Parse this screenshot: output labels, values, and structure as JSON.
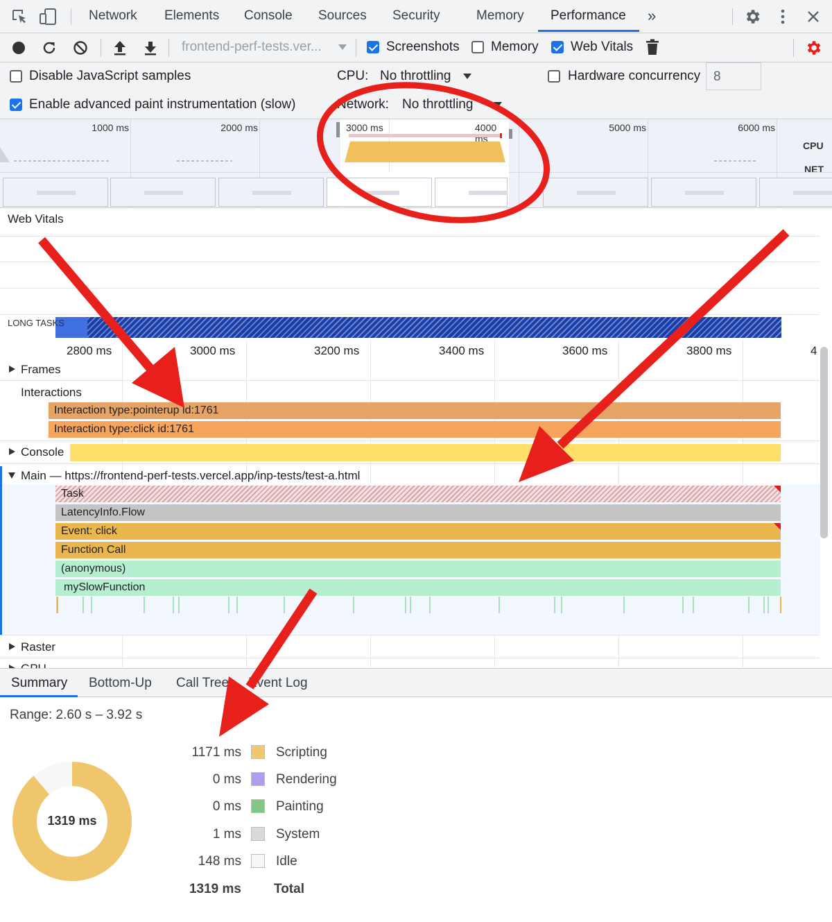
{
  "tabs": [
    "Network",
    "Elements",
    "Console",
    "Sources",
    "Security",
    "Memory",
    "Performance"
  ],
  "active_tab": "Performance",
  "more_tabs_glyph": "»",
  "toolbar": {
    "profile_select": "frontend-perf-tests.ver...",
    "screenshots_label": "Screenshots",
    "screenshots_checked": true,
    "memory_label": "Memory",
    "memory_checked": false,
    "webvitals_label": "Web Vitals",
    "webvitals_checked": true
  },
  "settings": {
    "disable_js_samples": "Disable JavaScript samples",
    "advanced_paint": "Enable advanced paint instrumentation (slow)",
    "cpu_label": "CPU:",
    "cpu_value": "No throttling",
    "network_label": "Network:",
    "network_value": "No throttling",
    "hw_label": "Hardware concurrency",
    "hw_value": "8"
  },
  "overview": {
    "ticks": [
      "1000 ms",
      "2000 ms",
      "3000 ms",
      "4000 ms",
      "5000 ms",
      "6000 ms"
    ],
    "cpu_label": "CPU",
    "net_label": "NET"
  },
  "timeline": {
    "web_vitals": "Web Vitals",
    "long_tasks": "LONG TASKS",
    "ruler": [
      "2800 ms",
      "3000 ms",
      "3200 ms",
      "3400 ms",
      "3600 ms",
      "3800 ms",
      "4"
    ],
    "frames": "Frames",
    "interactions": "Interactions",
    "interaction_1": "Interaction type:pointerup id:1761",
    "interaction_2": "Interaction type:click id:1761",
    "console": "Console",
    "main_prefix": "Main — ",
    "main_url": "https://frontend-perf-tests.vercel.app/inp-tests/test-a.html",
    "flame": [
      "Task",
      "LatencyInfo.Flow",
      "Event: click",
      "Function Call",
      "(anonymous)",
      "mySlowFunction"
    ],
    "raster": "Raster",
    "gpu_partial": "GPU"
  },
  "bottom_tabs": [
    "Summary",
    "Bottom-Up",
    "Call Tree",
    "Event Log"
  ],
  "summary": {
    "range": "Range: 2.60 s – 3.92 s",
    "donut_total": "1319 ms",
    "rows": [
      {
        "value": "1171 ms",
        "label": "Scripting",
        "color": "#f2c66d"
      },
      {
        "value": "0 ms",
        "label": "Rendering",
        "color": "#af9ef0"
      },
      {
        "value": "0 ms",
        "label": "Painting",
        "color": "#81c784"
      },
      {
        "value": "1 ms",
        "label": "System",
        "color": "#dadada"
      },
      {
        "value": "148 ms",
        "label": "Idle",
        "color": "#f7f7f7"
      }
    ],
    "total_value": "1319 ms",
    "total_label": "Total"
  },
  "colors": {
    "accent": "#1a73e8",
    "scripting": "#f0c66c",
    "annotation": "#e8201c",
    "long_task": "#1a3ea8",
    "interaction_1": "#e5a466",
    "interaction_2": "#f7a55c",
    "console": "#ffe06b",
    "js_function": "#b6eed0"
  }
}
